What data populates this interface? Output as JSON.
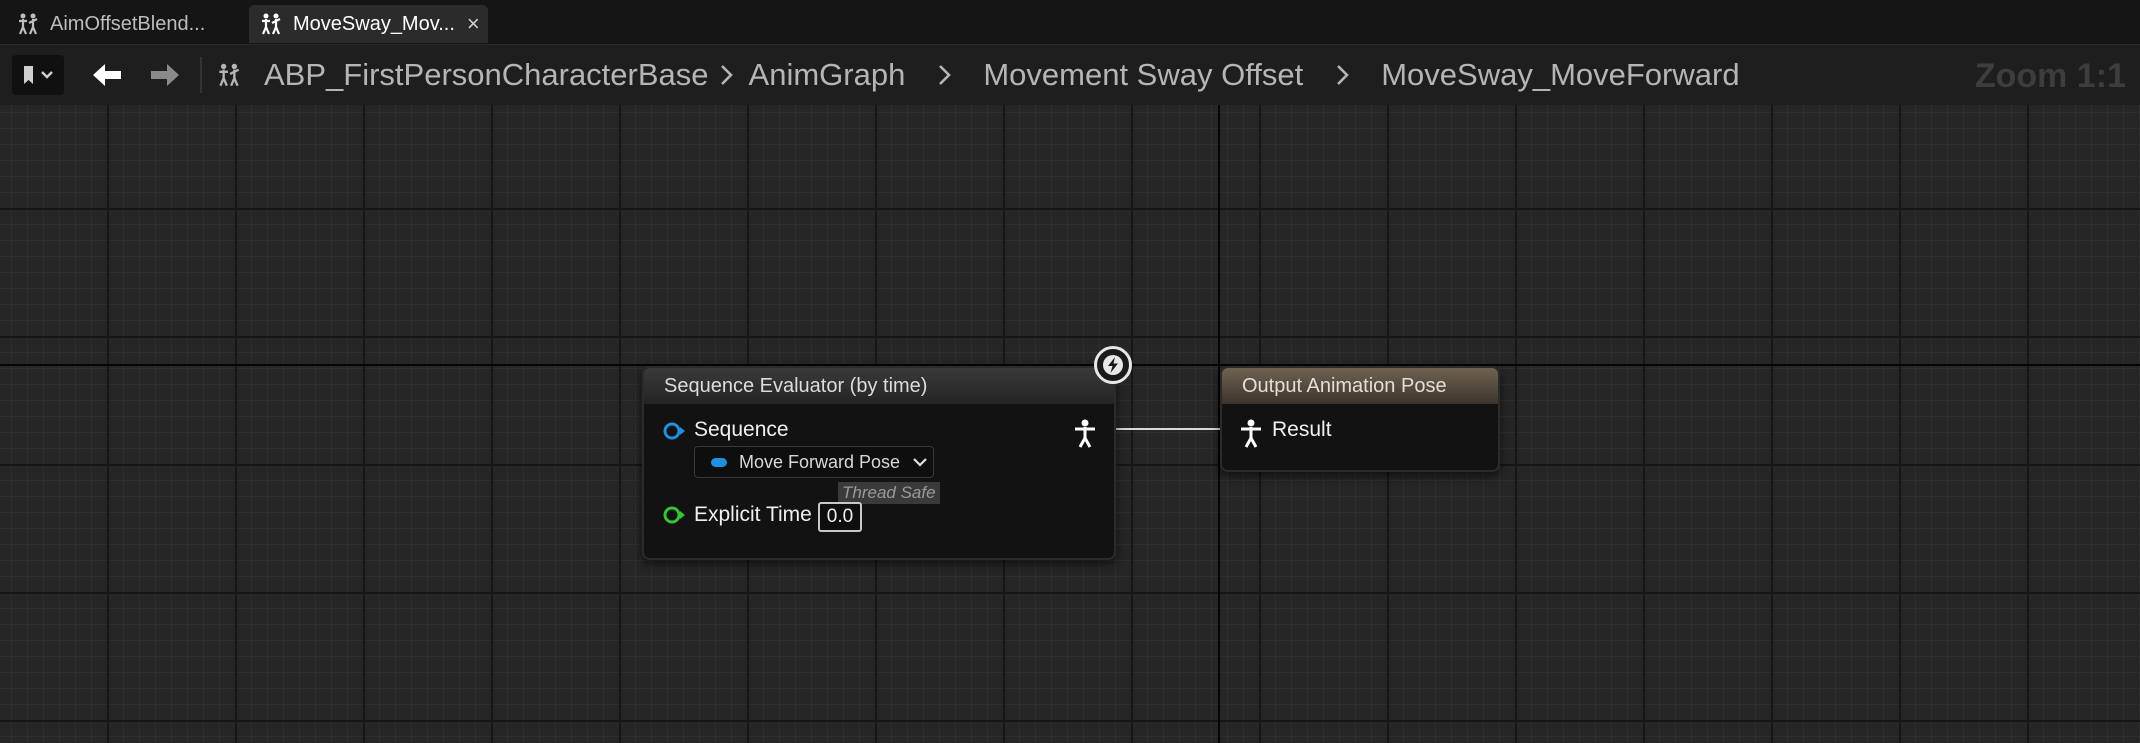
{
  "tabs": [
    {
      "label": "AimOffsetBlend...",
      "icon": "anim-blueprint-icon",
      "active": false
    },
    {
      "label": "MoveSway_Mov...",
      "icon": "anim-blueprint-icon",
      "active": true,
      "close": "×"
    }
  ],
  "breadcrumbs": {
    "items": [
      "ABP_FirstPersonCharacterBase",
      "AnimGraph",
      "Movement Sway Offset",
      "MoveSway_MoveForward"
    ],
    "zoom": "Zoom 1:1"
  },
  "nodes": {
    "sequence_evaluator": {
      "title": "Sequence Evaluator (by time)",
      "sequence_label": "Sequence",
      "sequence_value": "Move Forward Pose",
      "thread_safe": "Thread Safe",
      "explicit_time_label": "Explicit Time",
      "explicit_time_value": "0.0"
    },
    "output_pose": {
      "title": "Output Animation Pose",
      "result_label": "Result"
    }
  },
  "colors": {
    "sequence_pin": "#1f8fe0",
    "float_pin": "#32c632",
    "output_header": "#6f6252"
  }
}
